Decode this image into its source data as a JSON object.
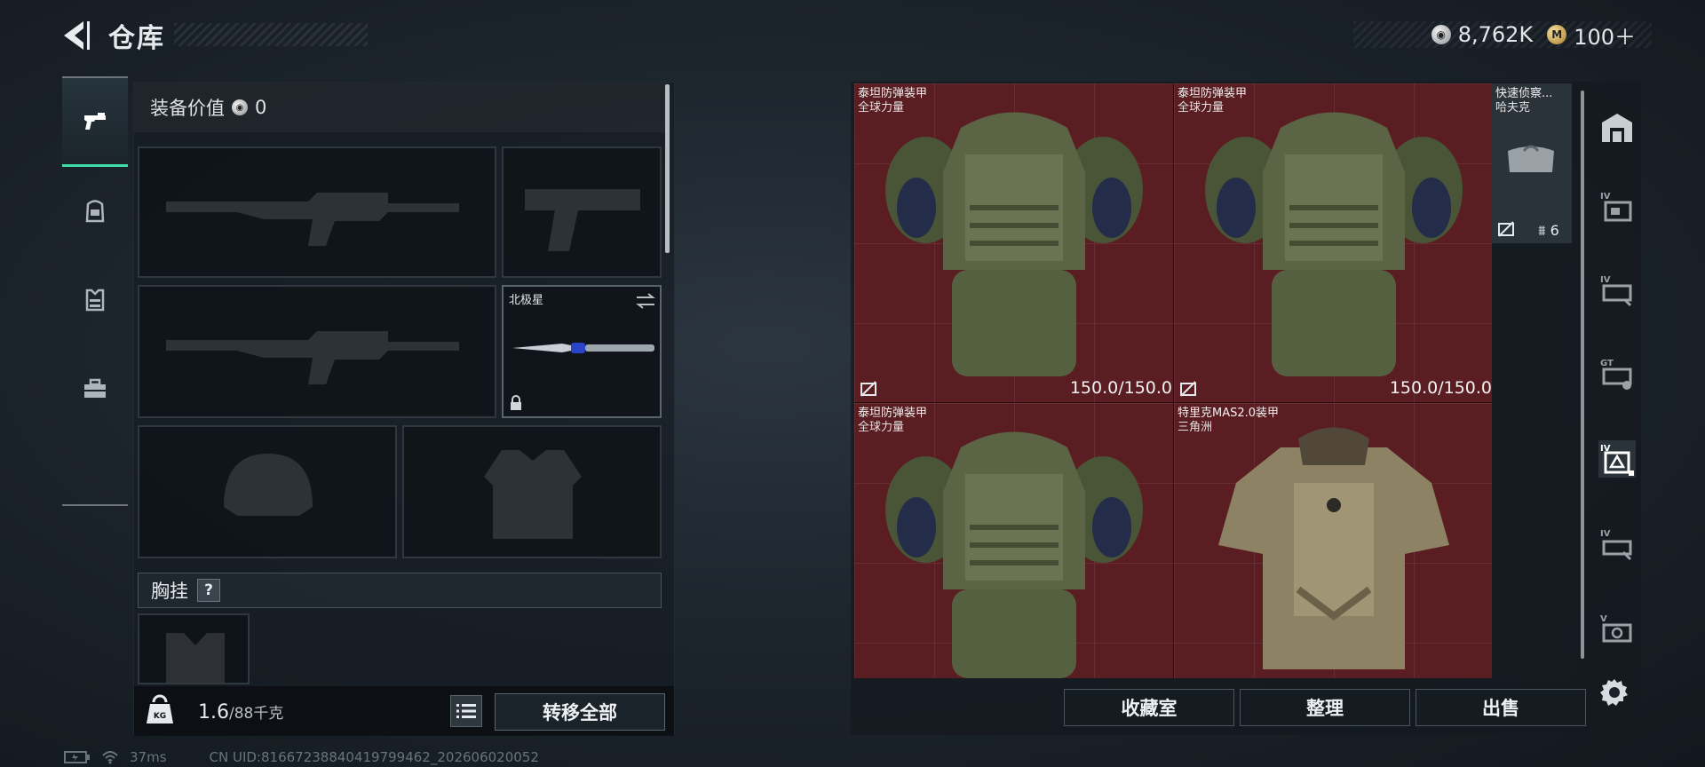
{
  "header": {
    "title": "仓库",
    "currencies": [
      {
        "icon": "silver-coin-icon",
        "value": "8,762K"
      },
      {
        "icon": "gold-coin-icon",
        "value": "100＋",
        "symbol": "M"
      }
    ]
  },
  "categories": [
    {
      "name": "firearms",
      "icon": "pistol-icon",
      "active": true
    },
    {
      "name": "backpacks",
      "icon": "backpack-icon",
      "active": false
    },
    {
      "name": "armor",
      "icon": "vest-icon",
      "active": false
    },
    {
      "name": "toolbox",
      "icon": "toolbox-icon",
      "active": false
    }
  ],
  "equipment": {
    "value_label": "装备价值",
    "value": "0",
    "melee_name": "北极星",
    "chest_label": "胸挂",
    "chest_help": "?",
    "weight_current": "1.6",
    "weight_max": "/88千克",
    "kg_icon_text": "KG",
    "transfer_all": "转移全部"
  },
  "storage": {
    "items": [
      {
        "name": "泰坦防弹装甲",
        "sub": "全球力量",
        "durability": "150.0/150.0"
      },
      {
        "name": "泰坦防弹装甲",
        "sub": "全球力量",
        "durability": "150.0/150.0"
      },
      {
        "name": "泰坦防弹装甲",
        "sub": "全球力量"
      },
      {
        "name": "特里克MAS2.0装甲",
        "sub": "三角洲"
      }
    ],
    "side_item": {
      "name": "快速侦察...",
      "sub": "哈夫克",
      "count": "6"
    },
    "buttons": {
      "collection": "收藏室",
      "sort": "整理",
      "sell": "出售"
    },
    "right_tab_labels": [
      "IV",
      "IV",
      "GT",
      "IV",
      "IV",
      "V"
    ]
  },
  "status": {
    "ping": "37ms",
    "uid": "CN UID:8166723884041979946​2_202606020052"
  },
  "colors": {
    "accent": "#3ee0a8",
    "grid_bg": "#5a1e22",
    "panel_bg": "#161c22"
  }
}
